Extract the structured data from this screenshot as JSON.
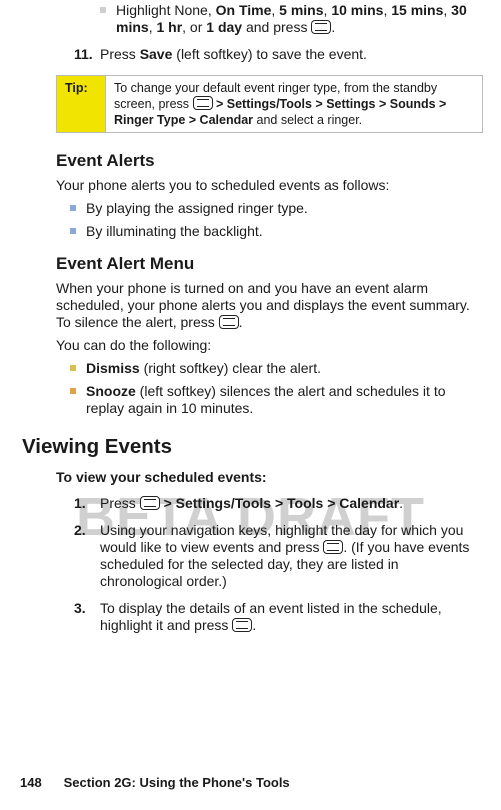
{
  "bullets_top": {
    "highlight_prefix": "Highlight None, ",
    "opt1": "On Time",
    "c1": ", ",
    "opt2": "5 mins",
    "c2": ", ",
    "opt3": "10 mins",
    "c3": ", ",
    "opt4": "15 mins",
    "c4": ", ",
    "opt5": "30 mins",
    "c5": ", ",
    "opt6": "1 hr",
    "c6": ", or ",
    "opt7": "1 day",
    "suffix": " and press "
  },
  "step11": {
    "num": "11.",
    "prefix": "Press ",
    "save": "Save",
    "suffix": " (left softkey) to save the event."
  },
  "tip": {
    "label": "Tip:",
    "line1": "To change your default event ringer type, from the standby screen, press ",
    "path": " > Settings/Tools > Settings > Sounds > Ringer Type > Calendar",
    "line2": " and select a ringer."
  },
  "alerts": {
    "heading": "Event Alerts",
    "intro": "Your phone alerts you to scheduled events as follows:",
    "b1": "By playing the assigned ringer type.",
    "b2": "By illuminating the backlight."
  },
  "menu": {
    "heading": "Event Alert Menu",
    "p1a": "When your phone is turned on and you have an event alarm scheduled, your phone alerts you and displays the event summary. To silence the alert, press ",
    "p1b": ".",
    "p2": "You can do the following:",
    "dismiss_label": "Dismiss",
    "dismiss_text": " (right softkey) clear the alert.",
    "snooze_label": "Snooze",
    "snooze_text": " (left softkey) silences the alert and schedules it to replay again in 10 minutes."
  },
  "viewing": {
    "heading": "Viewing Events",
    "lead": "To view your scheduled events:",
    "s1num": "1.",
    "s1a": "Press ",
    "s1path": " > Settings/Tools > Tools > Calendar",
    "s1b": ".",
    "s2num": "2.",
    "s2a": "Using your navigation keys, highlight the day for which you would like to view events and press ",
    "s2b": ". (If you have events scheduled for the selected day, they are listed in chronological order.)",
    "s3num": "3.",
    "s3a": "To display the details of an event listed in the schedule, highlight it and press ",
    "s3b": "."
  },
  "footer": {
    "page": "148",
    "section": "Section 2G: Using the Phone's Tools"
  },
  "watermark": "BETA DRAFT"
}
